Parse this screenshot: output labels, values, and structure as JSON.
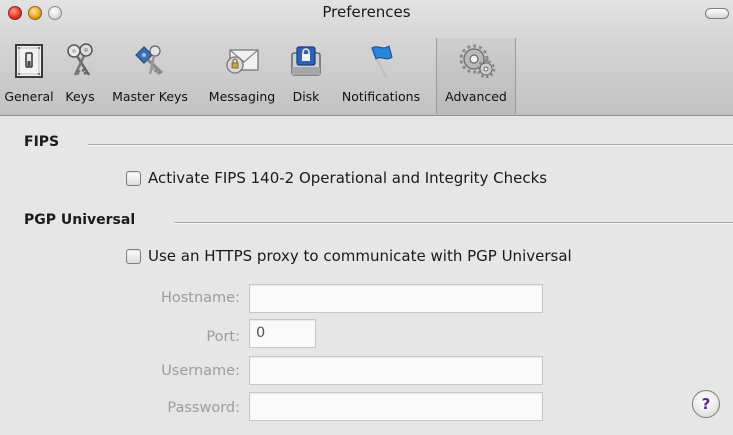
{
  "window": {
    "title": "Preferences"
  },
  "toolbar": {
    "items": [
      {
        "label": "General",
        "icon": "switch-icon",
        "selected": false
      },
      {
        "label": "Keys",
        "icon": "keys-icon",
        "selected": false
      },
      {
        "label": "Master Keys",
        "icon": "master-keys-icon",
        "selected": false
      },
      {
        "label": "Messaging",
        "icon": "envelope-icon",
        "selected": false
      },
      {
        "label": "Disk",
        "icon": "disk-lock-icon",
        "selected": false
      },
      {
        "label": "Notifications",
        "icon": "flag-icon",
        "selected": false
      },
      {
        "label": "Advanced",
        "icon": "gears-icon",
        "selected": true
      }
    ]
  },
  "fips": {
    "title": "FIPS",
    "checkbox_label": "Activate FIPS 140-2 Operational and Integrity Checks",
    "checked": false
  },
  "pgp_universal": {
    "title": "PGP Universal",
    "checkbox_label": "Use an HTTPS proxy to communicate with PGP Universal",
    "checked": false,
    "fields": {
      "hostname": {
        "label": "Hostname:",
        "value": ""
      },
      "port": {
        "label": "Port:",
        "value": "0"
      },
      "username": {
        "label": "Username:",
        "value": ""
      },
      "password": {
        "label": "Password:",
        "value": ""
      }
    }
  },
  "help": {
    "label": "?"
  }
}
